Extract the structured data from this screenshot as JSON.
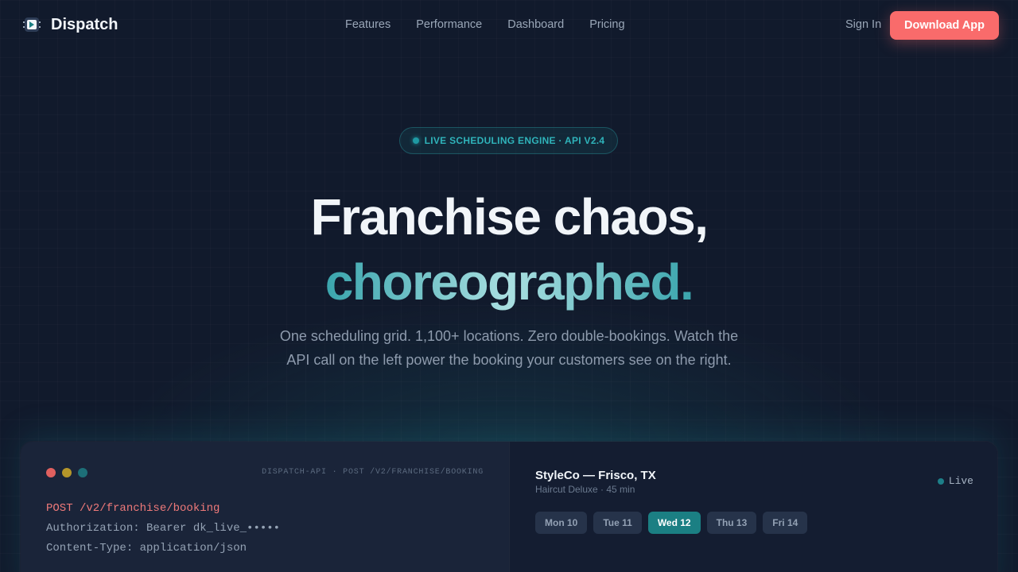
{
  "nav": {
    "brand": "Dispatch",
    "links": [
      "Features",
      "Performance",
      "Dashboard",
      "Pricing"
    ],
    "signin": "Sign In",
    "cta": "Download App"
  },
  "hero": {
    "badge": "LIVE SCHEDULING ENGINE · API V2.4",
    "title_line1": "Franchise chaos,",
    "title_line2": "choreographed.",
    "subtitle": "One scheduling grid. 1,100+ locations. Zero double-bookings. Watch the API call on the left power the booking your customers see on the right."
  },
  "code_panel": {
    "title": "DISPATCH-API · POST /V2/FRANCHISE/BOOKING",
    "lines": [
      "POST /v2/franchise/booking",
      "Authorization: Bearer dk_live_•••••",
      "Content-Type: application/json"
    ]
  },
  "schedule_panel": {
    "store": "StyleCo — Frisco, TX",
    "service": "Haircut Deluxe · 45 min",
    "status": "Live",
    "days": [
      "Mon 10",
      "Tue 11",
      "Wed 12",
      "Thu 13",
      "Fri 14"
    ],
    "selected_day": "Wed 12"
  },
  "colors": {
    "accent": "#f96b6b",
    "teal": "#1b7f83",
    "background": "#111a2c"
  },
  "icons": {
    "brand": "dispatch-logo-icon",
    "window_controls": [
      "red-dot",
      "yellow-dot",
      "teal-dot"
    ]
  }
}
